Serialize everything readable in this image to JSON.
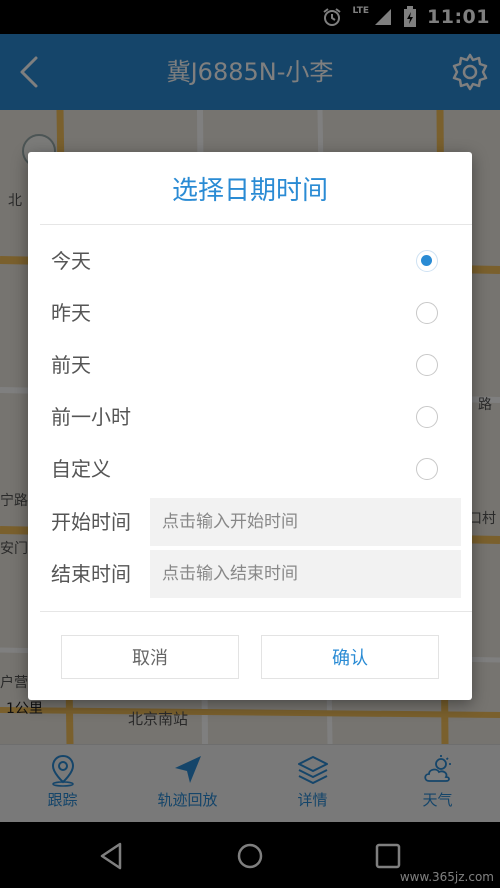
{
  "status_bar": {
    "time": "11:01",
    "network": "LTE"
  },
  "app_bar": {
    "title": "冀J6885N-小李"
  },
  "map": {
    "scale_label": "1公里",
    "station_label": "北京南站",
    "labels": [
      "北",
      "宁路",
      "安门",
      "户营",
      "口村",
      "路"
    ]
  },
  "dialog": {
    "title": "选择日期时间",
    "options": [
      {
        "label": "今天",
        "checked": true
      },
      {
        "label": "昨天",
        "checked": false
      },
      {
        "label": "前天",
        "checked": false
      },
      {
        "label": "前一小时",
        "checked": false
      },
      {
        "label": "自定义",
        "checked": false
      }
    ],
    "start": {
      "label": "开始时间",
      "placeholder": "点击输入开始时间"
    },
    "end": {
      "label": "结束时间",
      "placeholder": "点击输入结束时间"
    },
    "cancel_label": "取消",
    "confirm_label": "确认"
  },
  "tabs": [
    {
      "label": "跟踪",
      "icon": "location-pin-icon"
    },
    {
      "label": "轨迹回放",
      "icon": "navigation-arrow-icon"
    },
    {
      "label": "详情",
      "icon": "layers-icon"
    },
    {
      "label": "天气",
      "icon": "weather-cloud-icon"
    }
  ],
  "watermark": "www.365jz.com",
  "colors": {
    "accent": "#2a8bd4",
    "scrim": "rgba(0,0,0,0.5)"
  }
}
